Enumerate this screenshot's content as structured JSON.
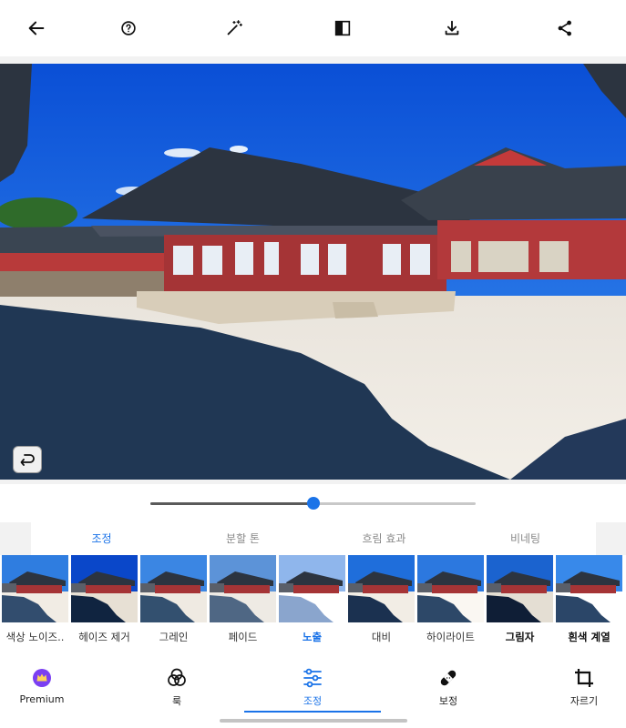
{
  "toolbar": {
    "icons": [
      "back-arrow-icon",
      "help-circle-icon",
      "magic-wand-icon",
      "compare-split-icon",
      "download-icon",
      "share-icon"
    ]
  },
  "photo": {
    "description_icon": "palace-photo",
    "undo_icon": "undo-icon"
  },
  "slider": {
    "value_fraction": 0.5
  },
  "subtabs": [
    {
      "label": "조정",
      "active": true
    },
    {
      "label": "분할 톤",
      "active": false
    },
    {
      "label": "흐림 효과",
      "active": false
    },
    {
      "label": "비네팅",
      "active": false
    }
  ],
  "filters": [
    {
      "label": "색상 노이즈.."
    },
    {
      "label": "헤이즈 제거"
    },
    {
      "label": "그레인"
    },
    {
      "label": "페이드"
    },
    {
      "label": "노출"
    },
    {
      "label": "대비"
    },
    {
      "label": "하이라이트"
    },
    {
      "label": "그림자"
    },
    {
      "label": "흰색 계열"
    }
  ],
  "bottom_nav": [
    {
      "label": "Premium",
      "icon": "crown-icon"
    },
    {
      "label": "룩",
      "icon": "venn-circles-icon"
    },
    {
      "label": "조정",
      "icon": "sliders-icon"
    },
    {
      "label": "보정",
      "icon": "bandage-icon"
    },
    {
      "label": "자르기",
      "icon": "crop-icon"
    }
  ],
  "colors": {
    "accent": "#1a73e8",
    "premium": "#7b3ff2"
  }
}
